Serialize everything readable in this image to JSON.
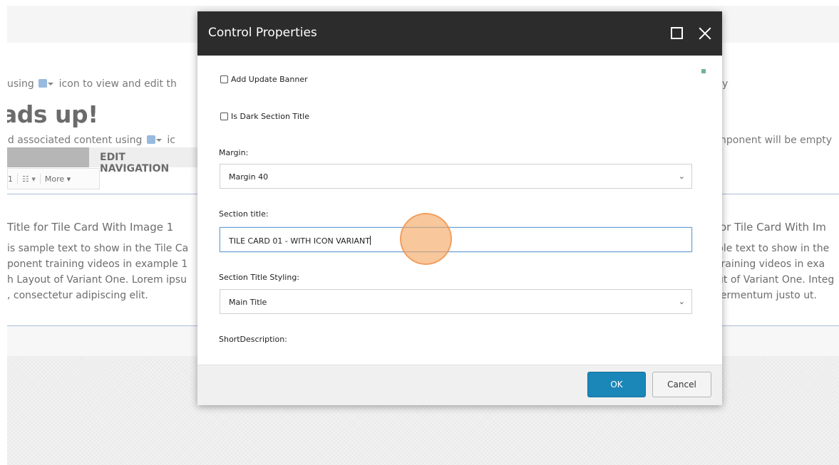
{
  "background": {
    "line1_left": "t using",
    "line1_left_rest": "icon to view and edit th",
    "line1_right": "y",
    "heading": "ads up!",
    "line3_left": "dd associated content using",
    "line3_left_rest": "ic",
    "line3_right": "nponent will be empty",
    "edit_navigation": "EDIT NAVIGATION",
    "toolbar": {
      "item1": "1",
      "more": "More ▾"
    },
    "card_left": {
      "title": "Title for Tile Card With Image 1",
      "body": [
        "is sample text to show in the Tile Ca",
        "ponent training videos in example 1",
        "h Layout of Variant One. Lorem ipsu",
        ", consectetur adipiscing elit."
      ]
    },
    "card_right": {
      "title": "or Tile Card With Im",
      "body": [
        "ple text to show in the",
        "training videos in exa",
        "ut of Variant One. Integ",
        "fermentum justo ut."
      ]
    }
  },
  "dialog": {
    "title": "Control Properties",
    "maximize_icon": "maximize-icon",
    "close_icon": "close-icon",
    "fields": {
      "add_update_banner": {
        "label": "Add Update Banner",
        "checked": false
      },
      "is_dark_section_title": {
        "label": "Is Dark Section Title",
        "checked": false
      },
      "margin": {
        "label": "Margin:",
        "value": "Margin 40"
      },
      "section_title": {
        "label": "Section title:",
        "value": "TILE CARD 01 - WITH ICON VARIANT"
      },
      "section_title_styling": {
        "label": "Section Title Styling:",
        "value": "Main Title"
      },
      "short_description": {
        "label": "ShortDescription:"
      }
    },
    "buttons": {
      "ok": "OK",
      "cancel": "Cancel"
    }
  },
  "colors": {
    "header_bg": "#2c2c2c",
    "ok_button": "#1b86b8",
    "input_focus_border": "#66a0d8",
    "click_indicator": "#f4a15a"
  }
}
